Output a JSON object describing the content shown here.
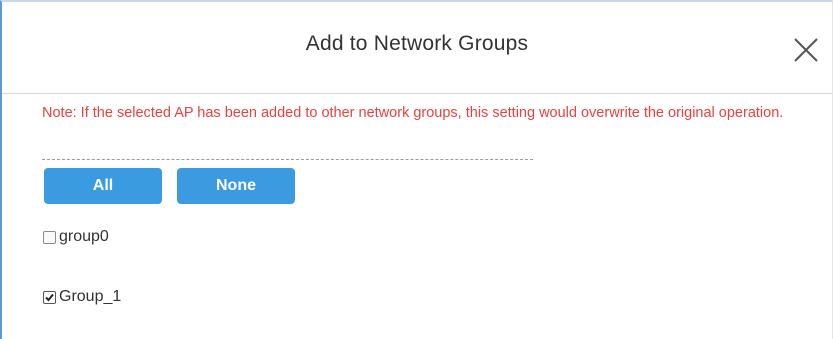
{
  "dialog": {
    "title": "Add to Network Groups",
    "close_icon": "close-icon",
    "note": "Note: If the selected AP has been added to other network groups, this setting would overwrite the original operation.",
    "buttons": {
      "all_label": "All",
      "none_label": "None"
    },
    "groups": [
      {
        "label": "group0",
        "checked": false
      },
      {
        "label": "Group_1",
        "checked": true
      }
    ]
  },
  "colors": {
    "note_text": "#e8413e",
    "button_bg": "#3a9be0",
    "dialog_border": "#5b9bd5"
  }
}
